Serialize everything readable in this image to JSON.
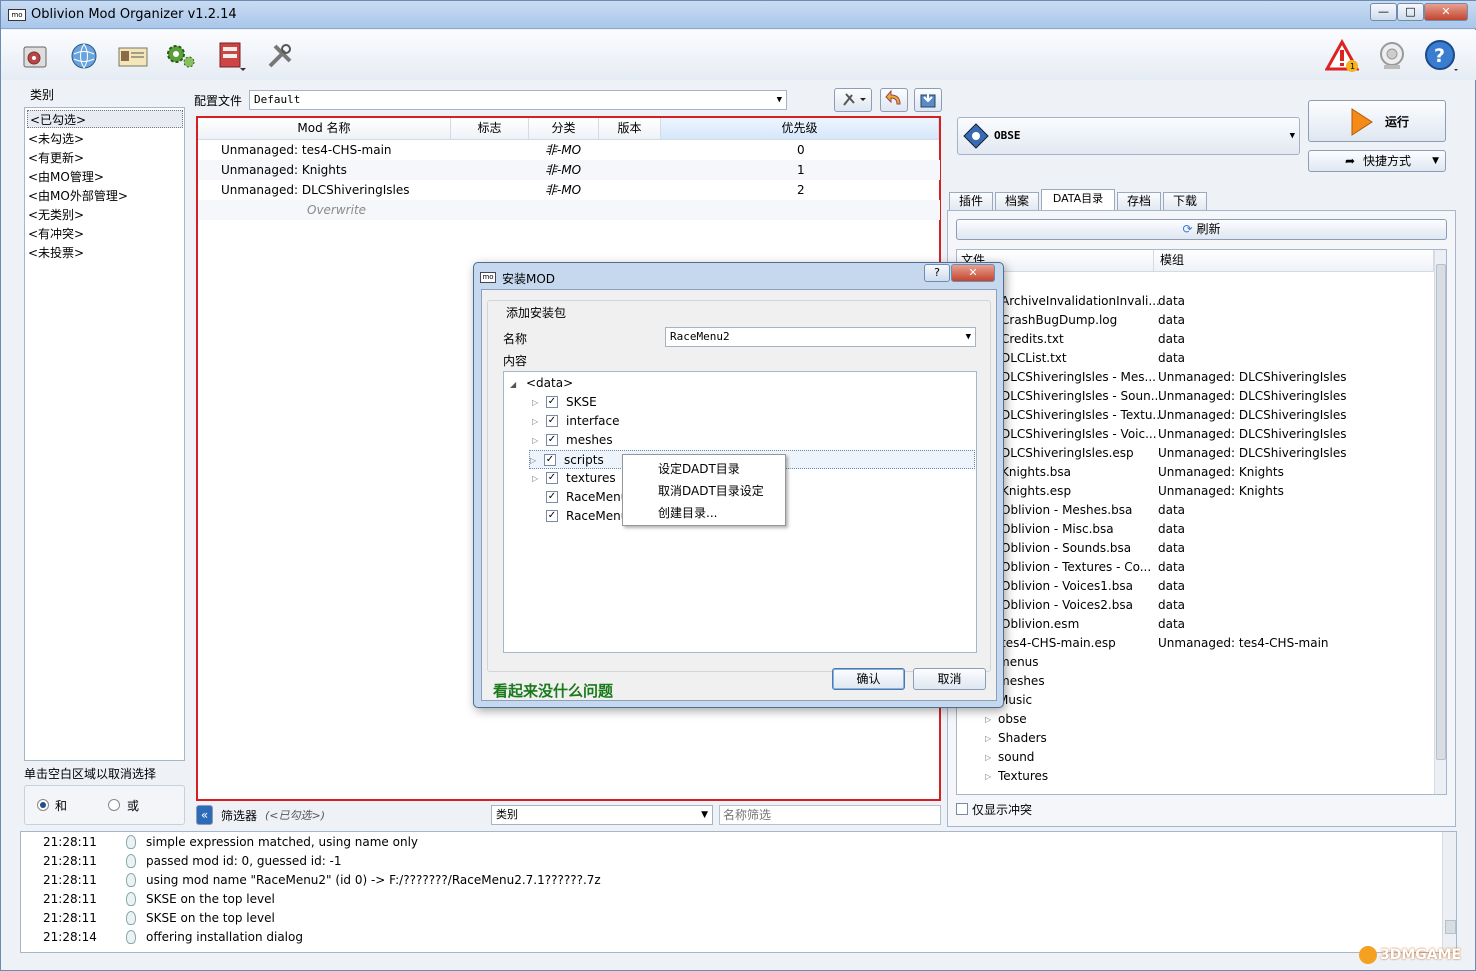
{
  "window": {
    "title": "Oblivion Mod Organizer v1.2.14",
    "logo": "mo",
    "min": "—",
    "max": "□",
    "close": "✕"
  },
  "toolbar": {
    "left_icons": [
      "install-mod-icon",
      "nexus-globe-icon",
      "profiles-icon",
      "executables-gear-icon",
      "tools-icon",
      "settings-wrench-icon"
    ],
    "right_icons": [
      "warning-icon",
      "update-icon",
      "help-icon"
    ]
  },
  "categories": {
    "label": "类别",
    "items": [
      "<已勾选>",
      "<未勾选>",
      "<有更新>",
      "<由MO管理>",
      "<由MO外部管理>",
      "<无类别>",
      "<有冲突>",
      "<未投票>"
    ],
    "hint": "单击空白区域以取消选择",
    "and": "和",
    "or": "或"
  },
  "profile": {
    "label": "配置文件",
    "value": "Default"
  },
  "modlist": {
    "headers": [
      "Mod 名称",
      "标志",
      "分类",
      "版本",
      "优先级"
    ],
    "rows": [
      {
        "name": "Unmanaged: tes4-CHS-main",
        "cat": "非-MO",
        "prio": "0"
      },
      {
        "name": "Unmanaged: Knights",
        "cat": "非-MO",
        "prio": "1"
      },
      {
        "name": "Unmanaged: DLCShiveringIsles",
        "cat": "非-MO",
        "prio": "2"
      }
    ],
    "overwrite": "Overwrite"
  },
  "filterbar": {
    "toggle": "«",
    "label": "筛选器",
    "state": "(<已勾选>)",
    "category": "类别",
    "name_placeholder": "名称筛选"
  },
  "run": {
    "exe": "OBSE",
    "run_label": "运行",
    "shortcut_label": "快捷方式"
  },
  "tabs": [
    "插件",
    "档案",
    "DATA目录",
    "存档",
    "下载"
  ],
  "data_tab": {
    "refresh": "刷新",
    "headers": [
      "文件",
      "模组"
    ],
    "rows": [
      {
        "file": "ArchiveInvalidationInvali...",
        "mod": "data"
      },
      {
        "file": "CrashBugDump.log",
        "mod": "data"
      },
      {
        "file": "Credits.txt",
        "mod": "data"
      },
      {
        "file": "DLCList.txt",
        "mod": "data"
      },
      {
        "file": "DLCShiveringIsles - Mes...",
        "mod": "Unmanaged: DLCShiveringIsles"
      },
      {
        "file": "DLCShiveringIsles - Soun...",
        "mod": "Unmanaged: DLCShiveringIsles"
      },
      {
        "file": "DLCShiveringIsles - Textu...",
        "mod": "Unmanaged: DLCShiveringIsles"
      },
      {
        "file": "DLCShiveringIsles - Voic...",
        "mod": "Unmanaged: DLCShiveringIsles"
      },
      {
        "file": "DLCShiveringIsles.esp",
        "mod": "Unmanaged: DLCShiveringIsles"
      },
      {
        "file": "Knights.bsa",
        "mod": "Unmanaged: Knights"
      },
      {
        "file": "Knights.esp",
        "mod": "Unmanaged: Knights"
      },
      {
        "file": "Oblivion - Meshes.bsa",
        "mod": "data"
      },
      {
        "file": "Oblivion - Misc.bsa",
        "mod": "data"
      },
      {
        "file": "Oblivion - Sounds.bsa",
        "mod": "data"
      },
      {
        "file": "Oblivion - Textures - Co...",
        "mod": "data"
      },
      {
        "file": "Oblivion - Voices1.bsa",
        "mod": "data"
      },
      {
        "file": "Oblivion - Voices2.bsa",
        "mod": "data"
      },
      {
        "file": "Oblivion.esm",
        "mod": "data"
      },
      {
        "file": "tes4-CHS-main.esp",
        "mod": "Unmanaged: tes4-CHS-main"
      },
      {
        "file": "menus",
        "mod": ""
      },
      {
        "file": "meshes",
        "mod": ""
      },
      {
        "file": "Music",
        "mod": ""
      },
      {
        "file": "obse",
        "mod": ""
      },
      {
        "file": "Shaders",
        "mod": ""
      },
      {
        "file": "sound",
        "mod": ""
      },
      {
        "file": "Textures",
        "mod": ""
      }
    ],
    "conflicts_only": "仅显示冲突"
  },
  "log": [
    {
      "time": "21:28:11",
      "text": "simple expression matched, using name only"
    },
    {
      "time": "21:28:11",
      "text": "passed mod id: 0, guessed id: -1"
    },
    {
      "time": "21:28:11",
      "text": "using mod name \"RaceMenu2\" (id 0) -> F:/???????/RaceMenu2.7.1??????.7z"
    },
    {
      "time": "21:28:11",
      "text": "SKSE on the top level"
    },
    {
      "time": "21:28:11",
      "text": "SKSE on the top level"
    },
    {
      "time": "21:28:14",
      "text": "offering installation dialog"
    }
  ],
  "dialog": {
    "title": "安装MOD",
    "logo": "mo",
    "help": "?",
    "close": "✕",
    "group": "添加安装包",
    "name_label": "名称",
    "name_value": "RaceMenu2",
    "content_label": "内容",
    "root": "<data>",
    "items": [
      "SKSE",
      "interface",
      "meshes",
      "scripts",
      "textures",
      "RaceMenu",
      "RaceMenu"
    ],
    "status": "看起来没什么问题",
    "ok": "确认",
    "cancel": "取消"
  },
  "context_menu": [
    "设定DADT目录",
    "取消DADT目录设定",
    "创建目录..."
  ],
  "watermark": "3DMGAME",
  "colors": {
    "accent": "#d42020",
    "status_green": "#1a7a1a",
    "selection": "#cfe3fb"
  }
}
